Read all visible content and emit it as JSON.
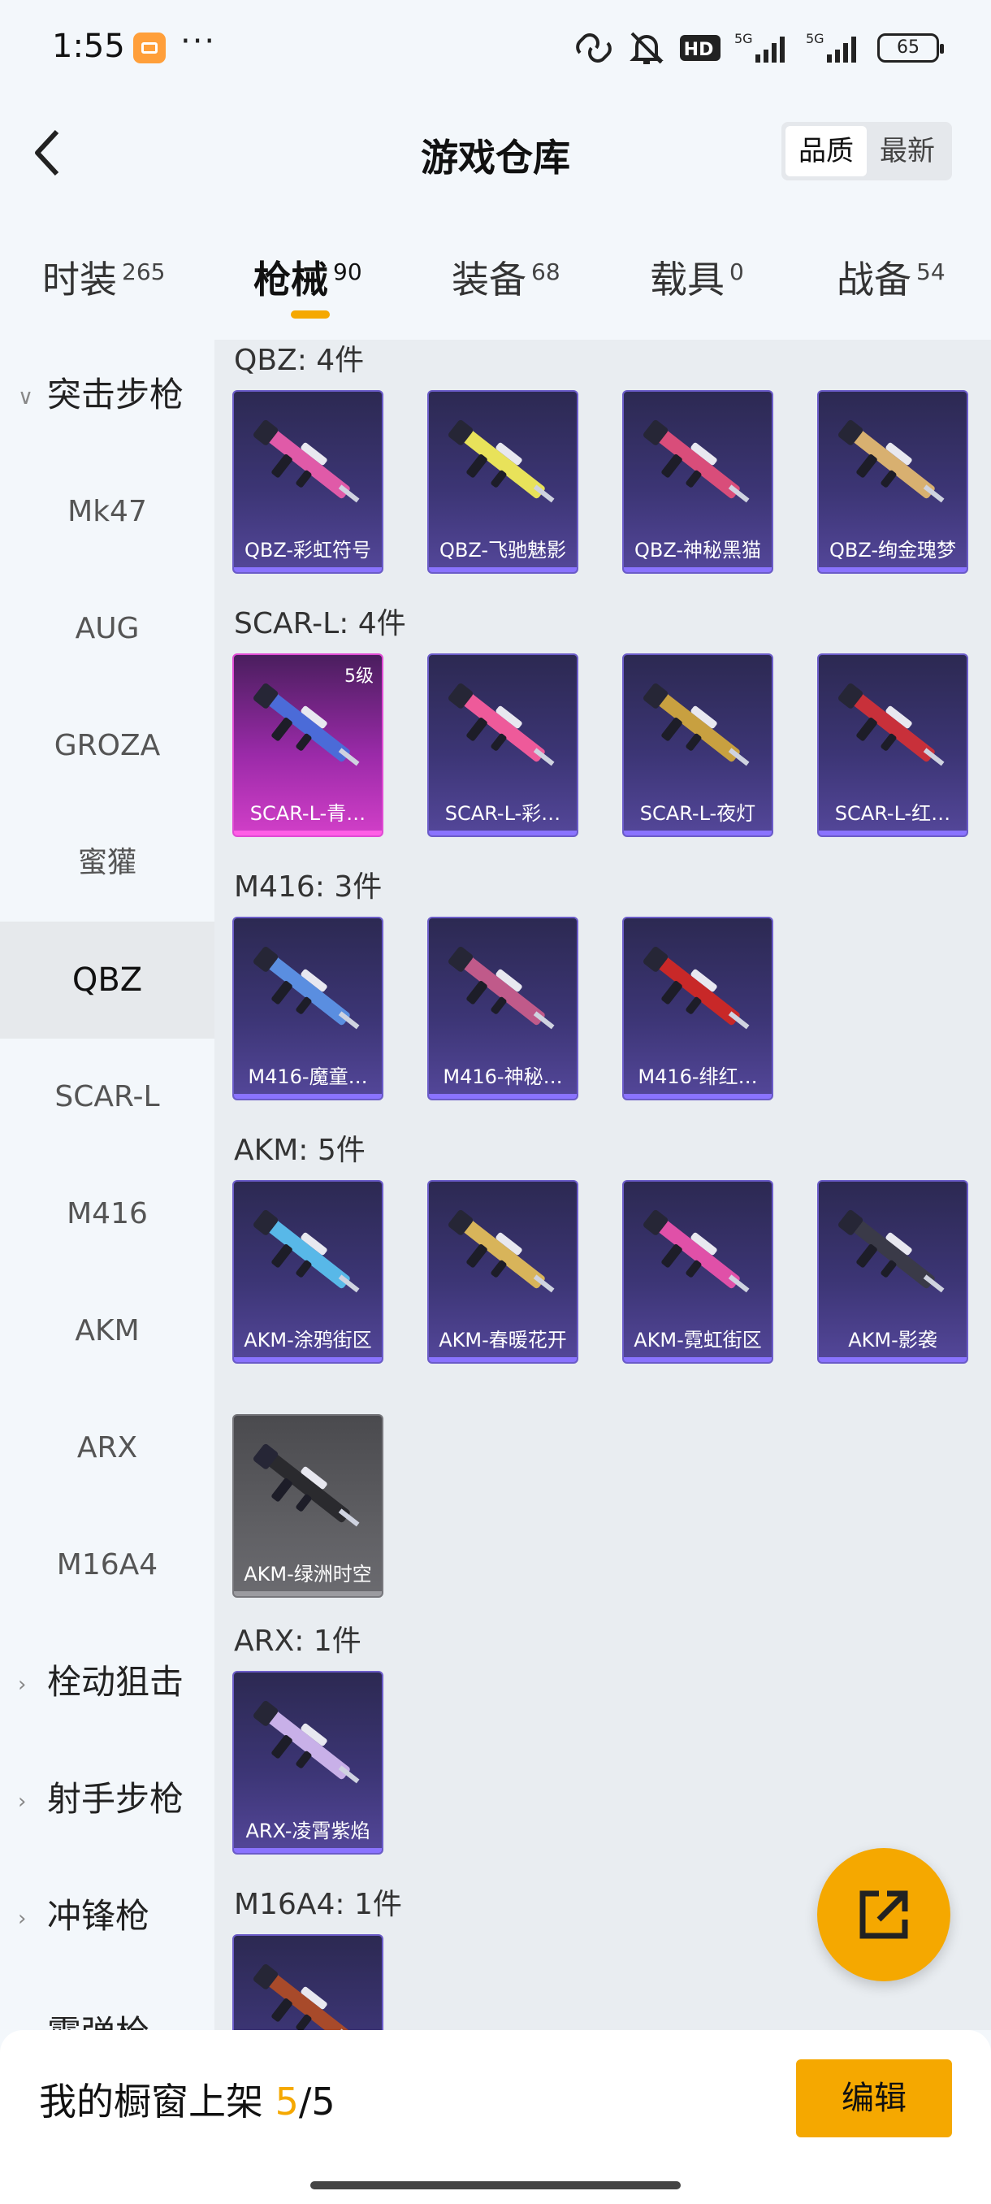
{
  "status": {
    "time": "1:55",
    "dots": "···",
    "battery": "65",
    "hd_label": "HD",
    "net1": "5G",
    "net2": "5G"
  },
  "header": {
    "title": "游戏仓库",
    "sort_quality": "品质",
    "sort_latest": "最新"
  },
  "tabs": [
    {
      "label": "时装",
      "count": "265"
    },
    {
      "label": "枪械",
      "count": "90"
    },
    {
      "label": "装备",
      "count": "68"
    },
    {
      "label": "载具",
      "count": "0"
    },
    {
      "label": "战备",
      "count": "54"
    }
  ],
  "sidebar": {
    "group_assault": "突击步枪",
    "items": [
      "Mk47",
      "AUG",
      "GROZA",
      "蜜獾",
      "QBZ",
      "SCAR-L",
      "M416",
      "AKM",
      "ARX",
      "M16A4"
    ],
    "group_bolt": "栓动狙击",
    "group_marksman": "射手步枪",
    "group_smg": "冲锋枪",
    "group_shotgun": "霰弹枪"
  },
  "sections": [
    {
      "title": "QBZ: 4件",
      "items": [
        {
          "name": "QBZ-彩虹符号",
          "color": "#e05aa8"
        },
        {
          "name": "QBZ-飞驰魅影",
          "color": "#e8e25a"
        },
        {
          "name": "QBZ-神秘黑猫",
          "color": "#d94d7a"
        },
        {
          "name": "QBZ-绚金瑰梦",
          "color": "#d8b070"
        }
      ]
    },
    {
      "title": "SCAR-L: 4件",
      "items": [
        {
          "name": "SCAR-L-青…",
          "color": "#4b6bd8",
          "level": "5级"
        },
        {
          "name": "SCAR-L-彩…",
          "color": "#ee5a9a"
        },
        {
          "name": "SCAR-L-夜灯",
          "color": "#c8a040"
        },
        {
          "name": "SCAR-L-红…",
          "color": "#c8303a"
        }
      ]
    },
    {
      "title": "M416: 3件",
      "items": [
        {
          "name": "M416-魔童…",
          "color": "#5a8ee0"
        },
        {
          "name": "M416-神秘…",
          "color": "#c05a8a"
        },
        {
          "name": "M416-绯红…",
          "color": "#c82828"
        }
      ]
    },
    {
      "title": "AKM: 5件",
      "items": [
        {
          "name": "AKM-涂鸦街区",
          "color": "#58b8e8"
        },
        {
          "name": "AKM-春暖花开",
          "color": "#d8b45a"
        },
        {
          "name": "AKM-霓虹街区",
          "color": "#e050a8"
        },
        {
          "name": "AKM-影袭",
          "color": "#3a3a48"
        },
        {
          "name": "AKM-绿洲时空",
          "color": "#2a2a2e"
        }
      ]
    },
    {
      "title": "ARX: 1件",
      "items": [
        {
          "name": "ARX-凌霄紫焰",
          "color": "#c8b0e8"
        }
      ]
    },
    {
      "title": "M16A4: 1件",
      "items": [
        {
          "name": "",
          "color": "#a84a2a"
        }
      ]
    }
  ],
  "bottom": {
    "prefix": "我的橱窗上架 ",
    "current": "5",
    "total": "/5",
    "edit": "编辑"
  }
}
